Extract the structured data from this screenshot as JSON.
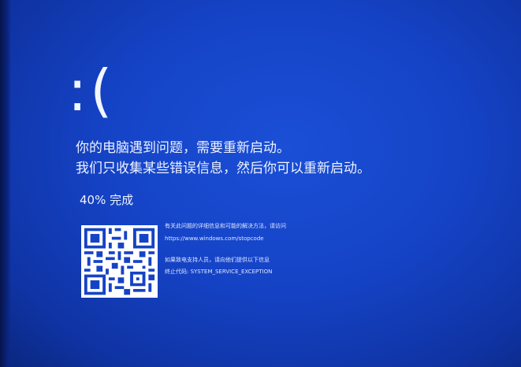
{
  "screen": {
    "face": ":(",
    "message_line1": "你的电脑遇到问题，需要重新启动。",
    "message_line2": "我们只收集某些错误信息，然后你可以重新启动。",
    "progress_percent": 40,
    "progress_text": "40% 完成",
    "details": {
      "info_text": "有关此问题的详细信息和可能的解决方法，请访问",
      "url": "https://www.windows.com/stopcode",
      "support_text": "如果致电支持人员，请向他们提供以下信息",
      "stop_code": "终止代码: SYSTEM_SERVICE_EXCEPTION"
    }
  },
  "colors": {
    "background": "#1543c6",
    "text": "#eef3ff",
    "qr_dark": "#1543c6",
    "qr_light": "#ffffff"
  }
}
